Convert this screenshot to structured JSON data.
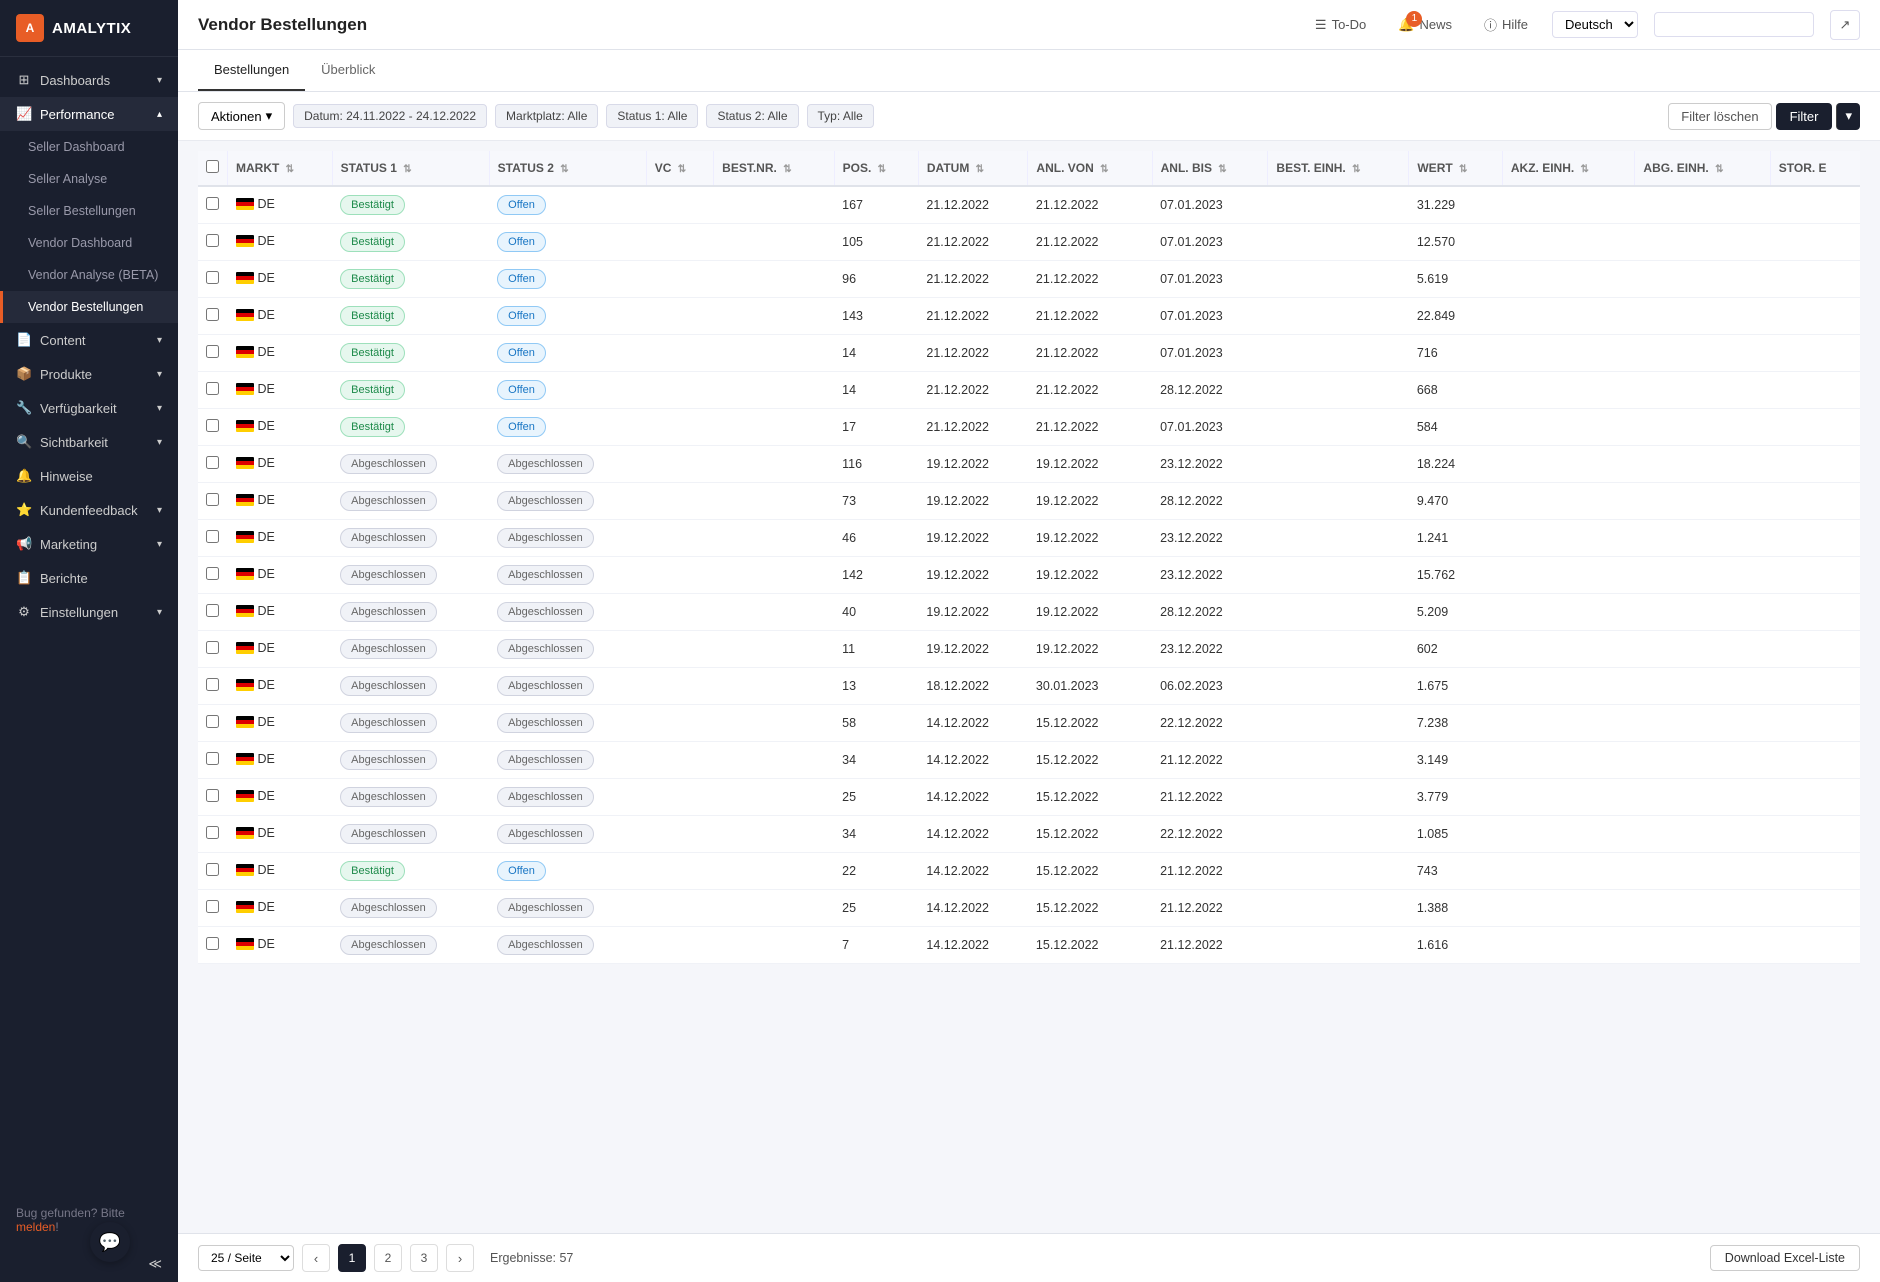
{
  "logo": {
    "text": "AMALYTIX",
    "icon": "A"
  },
  "sidebar": {
    "items": [
      {
        "id": "dashboards",
        "label": "Dashboards",
        "icon": "⊞",
        "hasChevron": true
      },
      {
        "id": "performance",
        "label": "Performance",
        "icon": "📈",
        "hasChevron": true,
        "expanded": true
      },
      {
        "id": "seller-dashboard",
        "label": "Seller Dashboard",
        "sub": true
      },
      {
        "id": "seller-analyse",
        "label": "Seller Analyse",
        "sub": true
      },
      {
        "id": "seller-bestellungen",
        "label": "Seller Bestellungen",
        "sub": true
      },
      {
        "id": "vendor-dashboard",
        "label": "Vendor Dashboard",
        "sub": true
      },
      {
        "id": "vendor-analyse",
        "label": "Vendor Analyse (BETA)",
        "sub": true
      },
      {
        "id": "vendor-bestellungen",
        "label": "Vendor Bestellungen",
        "sub": true,
        "active": true
      },
      {
        "id": "content",
        "label": "Content",
        "icon": "📄",
        "hasChevron": true
      },
      {
        "id": "produkte",
        "label": "Produkte",
        "icon": "📦",
        "hasChevron": true
      },
      {
        "id": "verfugbarkeit",
        "label": "Verfügbarkeit",
        "icon": "🔧",
        "hasChevron": true
      },
      {
        "id": "sichtbarkeit",
        "label": "Sichtbarkeit",
        "icon": "🔍",
        "hasChevron": true
      },
      {
        "id": "hinweise",
        "label": "Hinweise",
        "icon": "🔔",
        "hasChevron": false
      },
      {
        "id": "kundenfeedback",
        "label": "Kundenfeedback",
        "icon": "⭐",
        "hasChevron": true
      },
      {
        "id": "marketing",
        "label": "Marketing",
        "icon": "📢",
        "hasChevron": true
      },
      {
        "id": "berichte",
        "label": "Berichte",
        "icon": "📋",
        "hasChevron": false
      },
      {
        "id": "einstellungen",
        "label": "Einstellungen",
        "icon": "⚙",
        "hasChevron": true
      }
    ],
    "bug_text": "Bug gefunden? Bitte ",
    "bug_link": "melden",
    "bug_suffix": "!"
  },
  "topbar": {
    "page_title": "Vendor Bestellungen",
    "todo_label": "To-Do",
    "news_label": "News",
    "news_count": "1",
    "hilfe_label": "Hilfe",
    "lang_value": "Deutsch",
    "search_placeholder": ""
  },
  "tabs": [
    {
      "id": "bestellungen",
      "label": "Bestellungen",
      "active": true
    },
    {
      "id": "uberblick",
      "label": "Überblick",
      "active": false
    }
  ],
  "filters": {
    "actions_label": "Aktionen",
    "datum_label": "Datum: 24.11.2022 - 24.12.2022",
    "markt_label": "Marktplatz: Alle",
    "status1_label": "Status 1: Alle",
    "status2_label": "Status 2: Alle",
    "typ_label": "Typ: Alle",
    "filter_loschen_label": "Filter löschen",
    "filter_label": "Filter"
  },
  "table": {
    "columns": [
      "",
      "MARKT",
      "STATUS 1",
      "STATUS 2",
      "VC",
      "BEST.NR.",
      "POS.",
      "DATUM",
      "ANL. VON",
      "ANL. BIS",
      "BEST. EINH.",
      "WERT",
      "AKZ. EINH.",
      "ABG. EINH.",
      "STOR. E"
    ],
    "rows": [
      {
        "markt": "DE",
        "status1": "Bestätigt",
        "status2": "Offen",
        "vc": "",
        "bestnr": "",
        "pos": "167",
        "datum": "21.12.2022",
        "anl_von": "21.12.2022",
        "anl_bis": "07.01.2023",
        "best_einh": "",
        "wert": "31.229",
        "akz_einh": "",
        "abg_einh": "",
        "stor": ""
      },
      {
        "markt": "DE",
        "status1": "Bestätigt",
        "status2": "Offen",
        "vc": "",
        "bestnr": "",
        "pos": "105",
        "datum": "21.12.2022",
        "anl_von": "21.12.2022",
        "anl_bis": "07.01.2023",
        "best_einh": "",
        "wert": "12.570",
        "akz_einh": "",
        "abg_einh": "",
        "stor": ""
      },
      {
        "markt": "DE",
        "status1": "Bestätigt",
        "status2": "Offen",
        "vc": "",
        "bestnr": "",
        "pos": "96",
        "datum": "21.12.2022",
        "anl_von": "21.12.2022",
        "anl_bis": "07.01.2023",
        "best_einh": "",
        "wert": "5.619",
        "akz_einh": "",
        "abg_einh": "",
        "stor": ""
      },
      {
        "markt": "DE",
        "status1": "Bestätigt",
        "status2": "Offen",
        "vc": "",
        "bestnr": "",
        "pos": "143",
        "datum": "21.12.2022",
        "anl_von": "21.12.2022",
        "anl_bis": "07.01.2023",
        "best_einh": "",
        "wert": "22.849",
        "akz_einh": "",
        "abg_einh": "",
        "stor": ""
      },
      {
        "markt": "DE",
        "status1": "Bestätigt",
        "status2": "Offen",
        "vc": "",
        "bestnr": "",
        "pos": "14",
        "datum": "21.12.2022",
        "anl_von": "21.12.2022",
        "anl_bis": "07.01.2023",
        "best_einh": "",
        "wert": "716",
        "akz_einh": "",
        "abg_einh": "",
        "stor": ""
      },
      {
        "markt": "DE",
        "status1": "Bestätigt",
        "status2": "Offen",
        "vc": "",
        "bestnr": "",
        "pos": "14",
        "datum": "21.12.2022",
        "anl_von": "21.12.2022",
        "anl_bis": "28.12.2022",
        "best_einh": "",
        "wert": "668",
        "akz_einh": "",
        "abg_einh": "",
        "stor": ""
      },
      {
        "markt": "DE",
        "status1": "Bestätigt",
        "status2": "Offen",
        "vc": "",
        "bestnr": "",
        "pos": "17",
        "datum": "21.12.2022",
        "anl_von": "21.12.2022",
        "anl_bis": "07.01.2023",
        "best_einh": "",
        "wert": "584",
        "akz_einh": "",
        "abg_einh": "",
        "stor": ""
      },
      {
        "markt": "DE",
        "status1": "Abgeschlossen",
        "status2": "Abgeschlossen",
        "vc": "",
        "bestnr": "",
        "pos": "116",
        "datum": "19.12.2022",
        "anl_von": "19.12.2022",
        "anl_bis": "23.12.2022",
        "best_einh": "",
        "wert": "18.224",
        "akz_einh": "",
        "abg_einh": "",
        "stor": ""
      },
      {
        "markt": "DE",
        "status1": "Abgeschlossen",
        "status2": "Abgeschlossen",
        "vc": "",
        "bestnr": "",
        "pos": "73",
        "datum": "19.12.2022",
        "anl_von": "19.12.2022",
        "anl_bis": "28.12.2022",
        "best_einh": "",
        "wert": "9.470",
        "akz_einh": "",
        "abg_einh": "",
        "stor": ""
      },
      {
        "markt": "DE",
        "status1": "Abgeschlossen",
        "status2": "Abgeschlossen",
        "vc": "",
        "bestnr": "",
        "pos": "46",
        "datum": "19.12.2022",
        "anl_von": "19.12.2022",
        "anl_bis": "23.12.2022",
        "best_einh": "",
        "wert": "1.241",
        "akz_einh": "",
        "abg_einh": "",
        "stor": ""
      },
      {
        "markt": "DE",
        "status1": "Abgeschlossen",
        "status2": "Abgeschlossen",
        "vc": "",
        "bestnr": "",
        "pos": "142",
        "datum": "19.12.2022",
        "anl_von": "19.12.2022",
        "anl_bis": "23.12.2022",
        "best_einh": "",
        "wert": "15.762",
        "akz_einh": "",
        "abg_einh": "",
        "stor": ""
      },
      {
        "markt": "DE",
        "status1": "Abgeschlossen",
        "status2": "Abgeschlossen",
        "vc": "",
        "bestnr": "",
        "pos": "40",
        "datum": "19.12.2022",
        "anl_von": "19.12.2022",
        "anl_bis": "28.12.2022",
        "best_einh": "",
        "wert": "5.209",
        "akz_einh": "",
        "abg_einh": "",
        "stor": ""
      },
      {
        "markt": "DE",
        "status1": "Abgeschlossen",
        "status2": "Abgeschlossen",
        "vc": "",
        "bestnr": "",
        "pos": "11",
        "datum": "19.12.2022",
        "anl_von": "19.12.2022",
        "anl_bis": "23.12.2022",
        "best_einh": "",
        "wert": "602",
        "akz_einh": "",
        "abg_einh": "",
        "stor": ""
      },
      {
        "markt": "DE",
        "status1": "Abgeschlossen",
        "status2": "Abgeschlossen",
        "vc": "",
        "bestnr": "",
        "pos": "13",
        "datum": "18.12.2022",
        "anl_von": "30.01.2023",
        "anl_bis": "06.02.2023",
        "best_einh": "",
        "wert": "1.675",
        "akz_einh": "",
        "abg_einh": "",
        "stor": ""
      },
      {
        "markt": "DE",
        "status1": "Abgeschlossen",
        "status2": "Abgeschlossen",
        "vc": "",
        "bestnr": "",
        "pos": "58",
        "datum": "14.12.2022",
        "anl_von": "15.12.2022",
        "anl_bis": "22.12.2022",
        "best_einh": "",
        "wert": "7.238",
        "akz_einh": "",
        "abg_einh": "",
        "stor": ""
      },
      {
        "markt": "DE",
        "status1": "Abgeschlossen",
        "status2": "Abgeschlossen",
        "vc": "",
        "bestnr": "",
        "pos": "34",
        "datum": "14.12.2022",
        "anl_von": "15.12.2022",
        "anl_bis": "21.12.2022",
        "best_einh": "",
        "wert": "3.149",
        "akz_einh": "",
        "abg_einh": "",
        "stor": ""
      },
      {
        "markt": "DE",
        "status1": "Abgeschlossen",
        "status2": "Abgeschlossen",
        "vc": "",
        "bestnr": "",
        "pos": "25",
        "datum": "14.12.2022",
        "anl_von": "15.12.2022",
        "anl_bis": "21.12.2022",
        "best_einh": "",
        "wert": "3.779",
        "akz_einh": "",
        "abg_einh": "",
        "stor": ""
      },
      {
        "markt": "DE",
        "status1": "Abgeschlossen",
        "status2": "Abgeschlossen",
        "vc": "",
        "bestnr": "",
        "pos": "34",
        "datum": "14.12.2022",
        "anl_von": "15.12.2022",
        "anl_bis": "22.12.2022",
        "best_einh": "",
        "wert": "1.085",
        "akz_einh": "",
        "abg_einh": "",
        "stor": ""
      },
      {
        "markt": "DE",
        "status1": "Bestätigt",
        "status2": "Offen",
        "vc": "",
        "bestnr": "",
        "pos": "22",
        "datum": "14.12.2022",
        "anl_von": "15.12.2022",
        "anl_bis": "21.12.2022",
        "best_einh": "",
        "wert": "743",
        "akz_einh": "",
        "abg_einh": "",
        "stor": ""
      },
      {
        "markt": "DE",
        "status1": "Abgeschlossen",
        "status2": "Abgeschlossen",
        "vc": "",
        "bestnr": "",
        "pos": "25",
        "datum": "14.12.2022",
        "anl_von": "15.12.2022",
        "anl_bis": "21.12.2022",
        "best_einh": "",
        "wert": "1.388",
        "akz_einh": "",
        "abg_einh": "",
        "stor": ""
      },
      {
        "markt": "DE",
        "status1": "Abgeschlossen",
        "status2": "Abgeschlossen",
        "vc": "",
        "bestnr": "",
        "pos": "7",
        "datum": "14.12.2022",
        "anl_von": "15.12.2022",
        "anl_bis": "21.12.2022",
        "best_einh": "",
        "wert": "1.616",
        "akz_einh": "",
        "abg_einh": "",
        "stor": ""
      }
    ]
  },
  "pagination": {
    "page_size": "25 / Seite",
    "pages": [
      "1",
      "2",
      "3"
    ],
    "active_page": "1",
    "results_text": "Ergebnisse: 57",
    "download_label": "Download Excel-Liste"
  }
}
